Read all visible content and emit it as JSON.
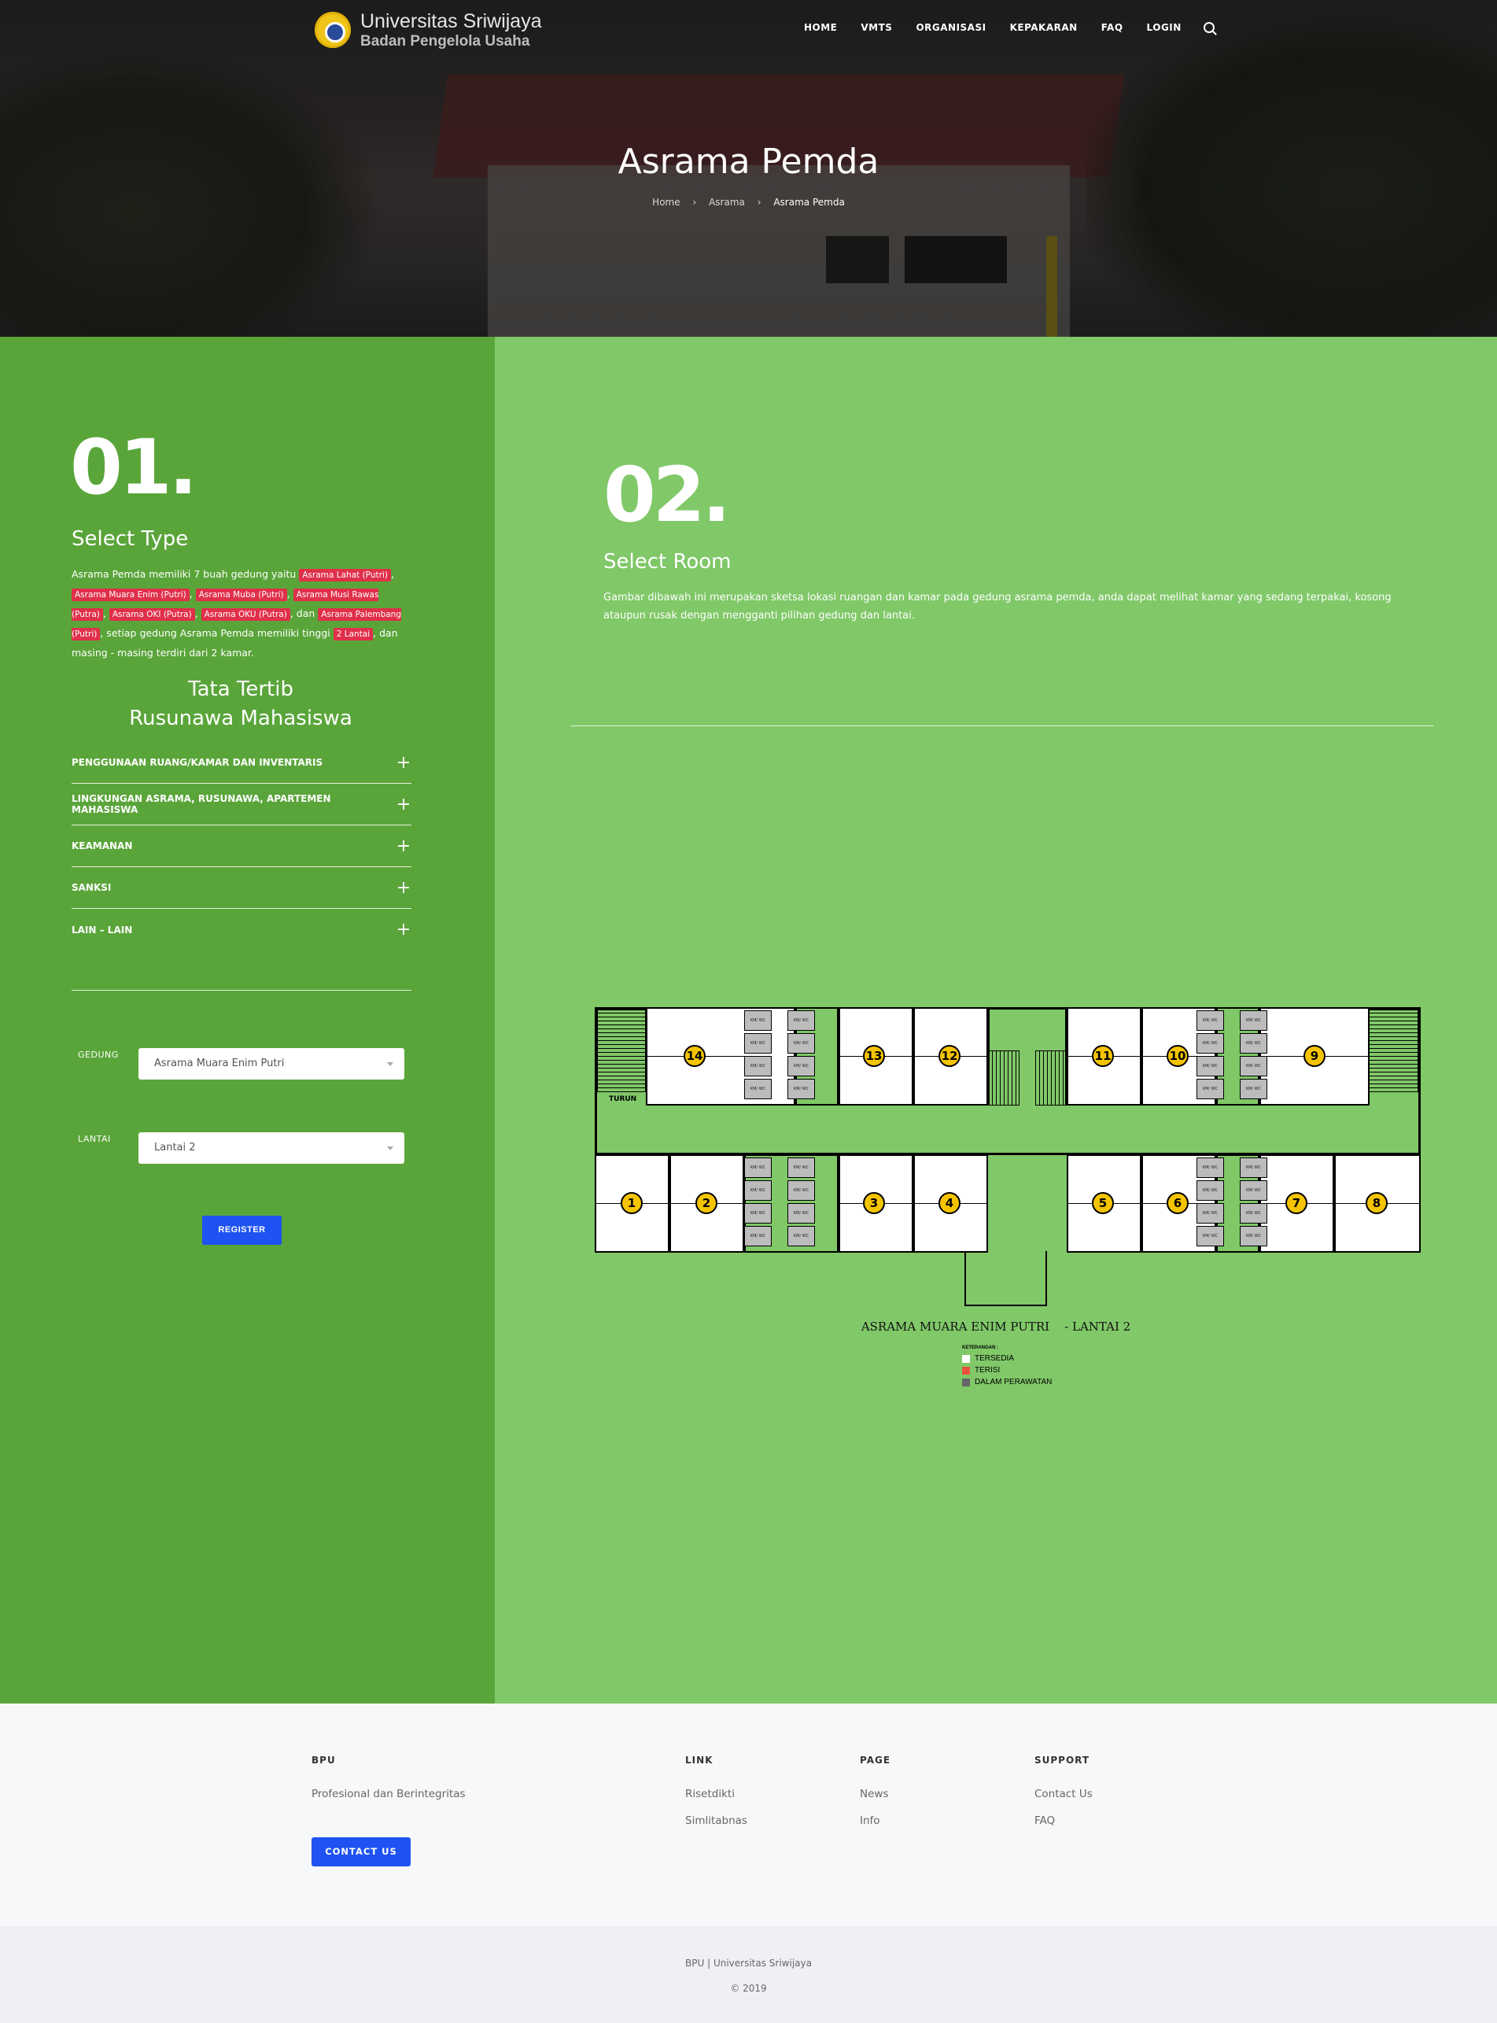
{
  "brand": {
    "line1": "Universitas Sriwijaya",
    "line2": "Badan Pengelola Usaha"
  },
  "nav": {
    "items": [
      "HOME",
      "VMTS",
      "ORGANISASI",
      "KEPAKARAN",
      "FAQ",
      "LOGIN"
    ]
  },
  "hero": {
    "title": "Asrama Pemda",
    "breadcrumb": [
      "Home",
      "Asrama",
      "Asrama Pemda"
    ]
  },
  "step1": {
    "number": "01.",
    "title": "Select Type",
    "intro": "Asrama Pemda memiliki 7 buah gedung yaitu",
    "buildings": [
      "Asrama Lahat (Putri)",
      "Asrama Muara Enim (Putri)",
      "Asrama Muba (Putri)",
      "Asrama Musi Rawas (Putra)",
      "Asrama OKI (Putra)",
      "Asrama OKU (Putra)",
      "Asrama Palembang (Putri)"
    ],
    "dan": ", dan",
    "mid": ", setiap gedung Asrama Pemda memiliki tinggi",
    "floors_tag": "2 Lantai",
    "end": ", dan masing - masing terdiri dari 2 kamar.",
    "rules_title_1": "Tata Tertib",
    "rules_title_2": "Rusunawa Mahasiswa",
    "accordion": [
      "PENGGUNAAN RUANG/KAMAR DAN INVENTARIS",
      "LINGKUNGAN ASRAMA, RUSUNAWA, APARTEMEN MAHASISWA",
      "KEAMANAN",
      "SANKSI",
      "LAIN – LAIN"
    ],
    "plus": "+",
    "gedung_label": "GEDUNG",
    "gedung_value": "Asrama Muara Enim Putri",
    "lantai_label": "LANTAI",
    "lantai_value": "Lantai 2",
    "register": "REGISTER"
  },
  "step2": {
    "number": "02.",
    "title": "Select Room",
    "description": "Gambar dibawah ini merupakan sketsa lokasi ruangan dan kamar pada gedung asrama pemda, anda dapat melihat kamar yang sedang terpakai, kosong ataupun rusak dengan mengganti pilihan gedung dan lantai."
  },
  "plan": {
    "caption": "ASRAMA MUARA ENIM PUTRI    - LANTAI 2",
    "turun": "TURUN",
    "wc_label": "KM/ WC",
    "rooms_top": [
      "14",
      "13",
      "12",
      "11",
      "10",
      "9"
    ],
    "rooms_bottom": [
      "1",
      "2",
      "3",
      "4",
      "5",
      "6",
      "7",
      "8"
    ],
    "legend_title": "KETERANGAN :",
    "legend": [
      {
        "label": "TERSEDIA",
        "color": "#ffffff"
      },
      {
        "label": "TERISI",
        "color": "#e8543a"
      },
      {
        "label": "DALAM PERAWATAN",
        "color": "#666666"
      }
    ]
  },
  "footer": {
    "bpu_title": "BPU",
    "bpu_text": "Profesional dan Berintegritas",
    "contact": "CONTACT US",
    "link_title": "LINK",
    "links": [
      "Risetdikti",
      "Simlitabnas"
    ],
    "page_title": "PAGE",
    "pages": [
      "News",
      "Info"
    ],
    "support_title": "SUPPORT",
    "support": [
      "Contact Us",
      "FAQ"
    ],
    "copyright": "BPU | Universitas Sriwijaya",
    "year": "© 2019"
  },
  "colors": {
    "left_panel": "#5aa53a",
    "right_panel": "#80c868",
    "button": "#1e52f2",
    "tag": "#e0304a",
    "room_badge": "#f5c400"
  }
}
